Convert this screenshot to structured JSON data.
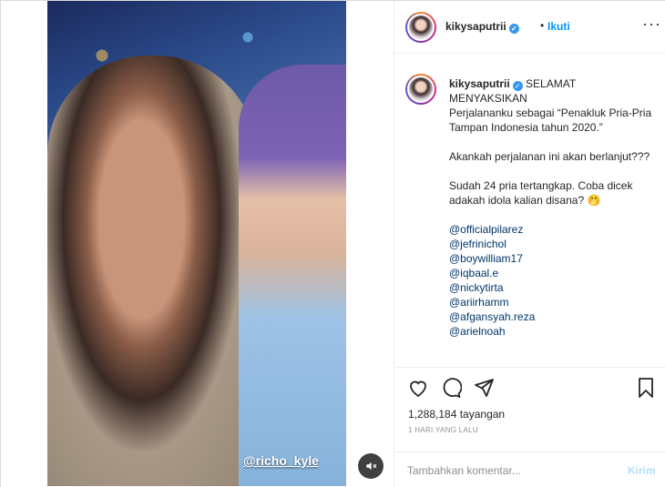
{
  "post": {
    "username": "kikysaputrii",
    "verified_icon": "verified-badge-icon",
    "separator": "•",
    "follow_label": "Ikuti",
    "more_label": "···",
    "video": {
      "watermark": "@richo_kyle",
      "mute_icon": "mute-icon"
    },
    "caption": {
      "username": "kikysaputrii",
      "line1": "SELAMAT MENYAKSIKAN",
      "line2": "Perjalananku sebagai “Penakluk Pria-Pria Tampan Indonesia tahun 2020.”",
      "line3": "Akankah perjalanan ini akan berlanjut???",
      "line4": "Sudah 24 pria tertangkap. Coba dicek adakah idola kalian disana? 🤭",
      "mentions": [
        "@officialpilarez",
        "@jefrinichol",
        "@boywilliam17",
        "@iqbaal.e",
        "@nickytirta",
        "@ariirhamm",
        "@afgansyah.reza",
        "@arielnoah"
      ]
    },
    "views": "1,288,184 tayangan",
    "timestamp": "1 HARI YANG LALU",
    "comment_placeholder": "Tambahkan komentar...",
    "post_label": "Kirim",
    "colors": {
      "link": "#0095f6",
      "mention": "#00376b",
      "muted": "#8e8e8e",
      "post_disabled": "#b2dffc"
    }
  }
}
